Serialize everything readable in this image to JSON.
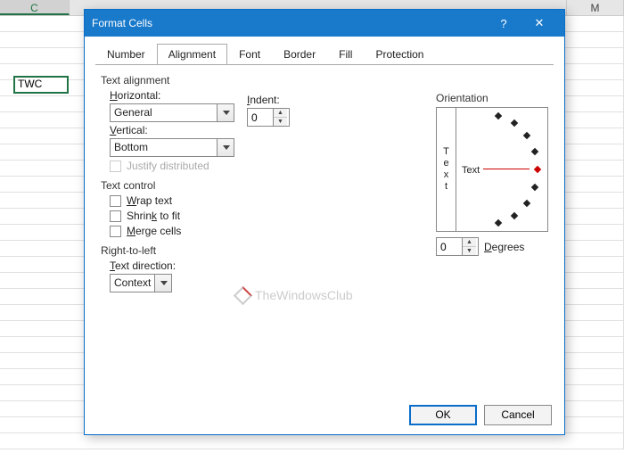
{
  "sheet": {
    "columns": [
      "C",
      "M"
    ],
    "cell_value": "TWC"
  },
  "dialog": {
    "title": "Format Cells",
    "tabs": [
      "Number",
      "Alignment",
      "Font",
      "Border",
      "Fill",
      "Protection"
    ],
    "active_tab": 1,
    "alignment": {
      "section": "Text alignment",
      "horizontal_label": "Horizontal:",
      "horizontal_value": "General",
      "indent_label": "Indent:",
      "indent_value": "0",
      "vertical_label": "Vertical:",
      "vertical_value": "Bottom",
      "justify_label": "Justify distributed"
    },
    "control": {
      "section": "Text control",
      "wrap": "Wrap text",
      "shrink": "Shrink to fit",
      "merge": "Merge cells"
    },
    "rtl": {
      "section": "Right-to-left",
      "direction_label": "Text direction:",
      "direction_value": "Context"
    },
    "orientation": {
      "section": "Orientation",
      "vertical_text": "Text",
      "main_text": "Text",
      "degrees_value": "0",
      "degrees_label": "Degrees"
    },
    "buttons": {
      "ok": "OK",
      "cancel": "Cancel"
    }
  },
  "watermark": "TheWindowsClub"
}
